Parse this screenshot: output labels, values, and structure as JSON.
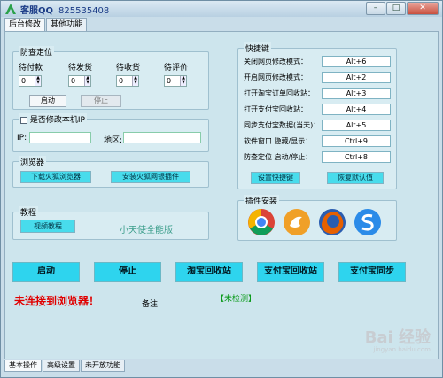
{
  "window": {
    "title": "客服QQ",
    "qq_number": "825535408"
  },
  "top_tabs": [
    "后台修改",
    "其他功能"
  ],
  "timer_group": {
    "legend": "防查定位",
    "columns": [
      {
        "label": "待付款",
        "value": "0"
      },
      {
        "label": "待发货",
        "value": "0"
      },
      {
        "label": "待收货",
        "value": "0"
      },
      {
        "label": "待评价",
        "value": "0"
      }
    ],
    "start_label": "启动",
    "stop_label": "停止"
  },
  "ip_group": {
    "legend": "是否修改本机IP",
    "ip_label": "IP:",
    "ip_value": "",
    "region_label": "地区:",
    "region_value": ""
  },
  "browser_group": {
    "legend": "浏览器",
    "download_label": "下载火狐浏览器",
    "install_label": "安装火狐网银插件"
  },
  "tutorial_group": {
    "legend": "教程",
    "video_label": "视频教程",
    "version_text": "小天使全能版"
  },
  "hotkey_group": {
    "legend": "快捷键",
    "rows": [
      {
        "label": "关闭网页修改模式：",
        "key": "Alt+6"
      },
      {
        "label": "开启网页修改模式：",
        "key": "Alt+2"
      },
      {
        "label": "打开淘宝订单回收站：",
        "key": "Alt+3"
      },
      {
        "label": "打开支付宝回收站：",
        "key": "Alt+4"
      },
      {
        "label": "同步支付宝数据(当天)：",
        "key": "Alt+5"
      },
      {
        "label": "软件窗口 隐藏/显示：",
        "key": "Ctrl+9"
      },
      {
        "label": "防查定位 启动/停止：",
        "key": "Ctrl+8"
      }
    ],
    "set_label": "设置快捷键",
    "restore_label": "恢复默认值"
  },
  "plugin_group": {
    "legend": "插件安装",
    "plugins": [
      "chrome-icon",
      "uc-browser-icon",
      "firefox-icon",
      "sogou-browser-icon"
    ]
  },
  "action_buttons": [
    "启动",
    "停止",
    "淘宝回收站",
    "支付宝回收站",
    "支付宝同步"
  ],
  "status": {
    "error_text": "未连接到浏览器！",
    "error_color": "#e00000",
    "note_label": "备注:",
    "detect_text": "【未检测】",
    "detect_color": "#0a9a1a"
  },
  "bottom_tabs": [
    "基本操作",
    "高级设置",
    "未开放功能"
  ],
  "watermark": {
    "text": "Bai 经验",
    "sub": "jingyan.baidu.com"
  },
  "colors": {
    "accent": "#2ed4ee",
    "panel": "#cde5ed"
  }
}
